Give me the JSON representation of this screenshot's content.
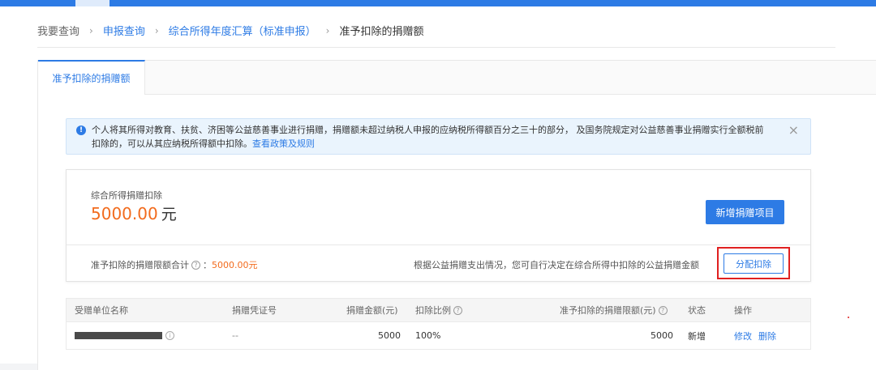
{
  "breadcrumb": {
    "items": [
      "我要查询",
      "申报查询",
      "综合所得年度汇算（标准申报）",
      "准予扣除的捐赠额"
    ],
    "separator": "›"
  },
  "tabs": [
    {
      "label": "准予扣除的捐赠额",
      "active": true
    }
  ],
  "notice": {
    "icon": "info-icon",
    "text": "个人将其所得对教育、扶贫、济困等公益慈善事业进行捐赠，捐赠额未超过纳税人申报的应纳税所得额百分之三十的部分， 及国务院规定对公益慈善事业捐赠实行全额税前扣除的，可以从其应纳税所得额中扣除。",
    "link": "查看政策及规则",
    "close": "×"
  },
  "summary": {
    "label": "综合所得捐赠扣除",
    "amount": "5000.00",
    "unit": "元",
    "add_button": "新增捐赠项目",
    "limit_label": "准予扣除的捐赠限额合计",
    "limit_colon": "：",
    "limit_value": "5000.00元",
    "hint": "根据公益捐赠支出情况，您可自行决定在综合所得中扣除的公益捐赠金额",
    "allocate_button": "分配扣除"
  },
  "table": {
    "headers": [
      "受赠单位名称",
      "捐赠凭证号",
      "捐赠金额(元)",
      "扣除比例",
      "准予扣除的捐赠限额(元)",
      "状态",
      "操作"
    ],
    "rows": [
      {
        "name": "",
        "voucher": "--",
        "amount": "5000",
        "ratio": "100%",
        "limit": "5000",
        "status": "新增",
        "edit": "修改",
        "delete": "删除"
      }
    ]
  },
  "colors": {
    "accent": "#2d7be5",
    "amount": "#f26b1d",
    "highlight": "#e02020"
  }
}
